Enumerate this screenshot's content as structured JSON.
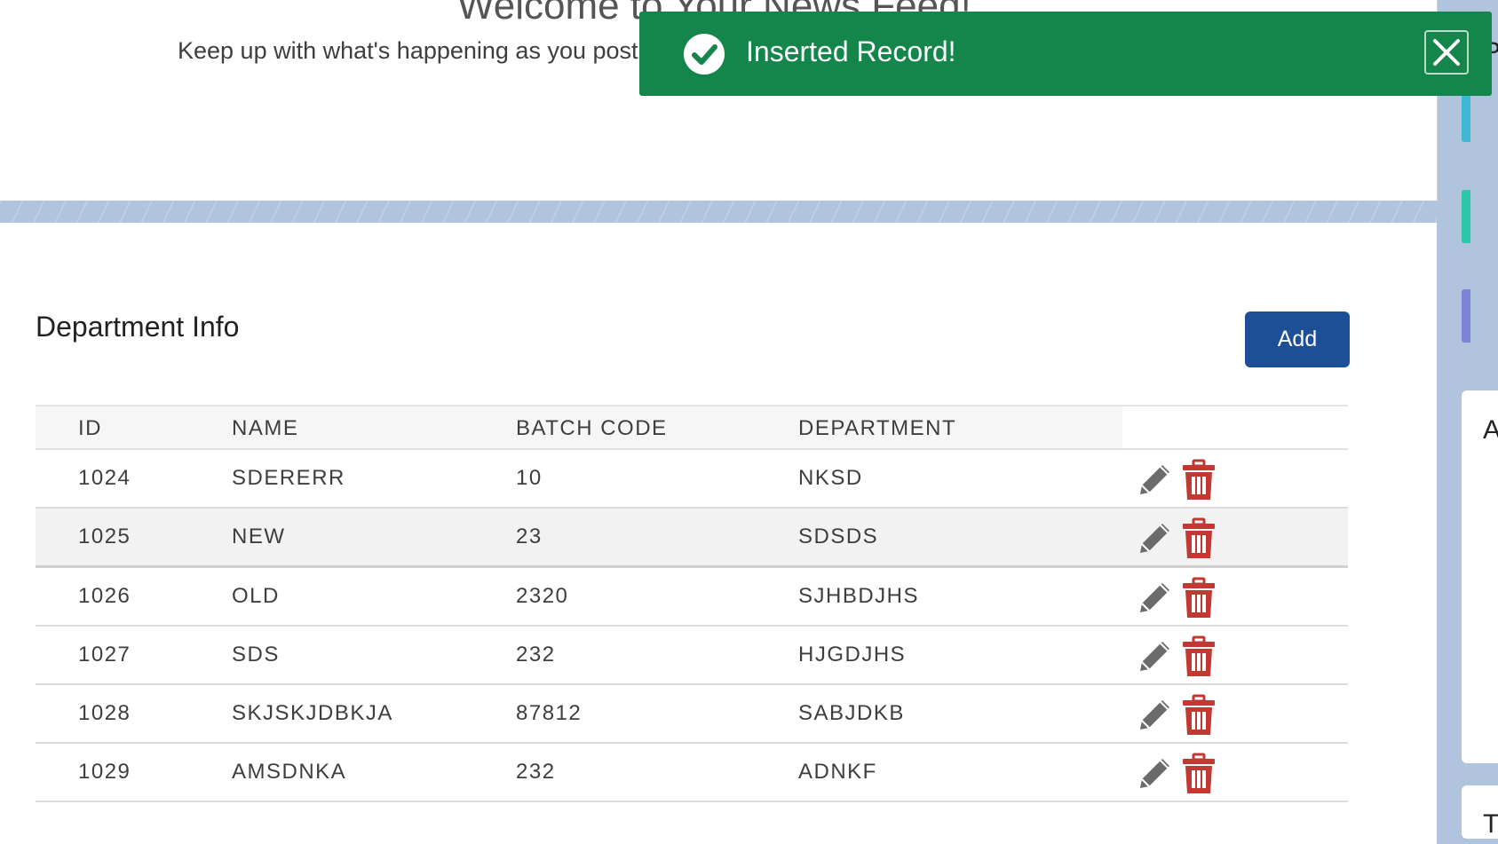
{
  "welcome": {
    "title": "Welcome to Your News Feed!",
    "subtitle": "Keep up with what's happening as you post"
  },
  "toast": {
    "message": "Inserted Record!",
    "icon": "checkmark-icon",
    "close_icon": "close-icon",
    "color": "#14854b"
  },
  "section": {
    "title": "Department Info",
    "add_label": "Add",
    "accent": "#1c4f96"
  },
  "table": {
    "headers": [
      "ID",
      "NAME",
      "BATCH CODE",
      "DEPARTMENT"
    ],
    "rows": [
      [
        "1024",
        "SDERERR",
        "10",
        "NKSD"
      ],
      [
        "1025",
        "NEW",
        "23",
        "SDSDS"
      ],
      [
        "1026",
        "OLD",
        "2320",
        "SJHBDJHS"
      ],
      [
        "1027",
        "SDS",
        "232",
        "HJGDJHS"
      ],
      [
        "1028",
        "SKJSKJDBKJA",
        "87812",
        "SABJDKB"
      ],
      [
        "1029",
        "AMSDNKA",
        "232",
        "ADNKF"
      ]
    ],
    "row_actions": [
      "edit-icon",
      "delete-icon"
    ],
    "delete_color": "#c23934"
  },
  "right_rail": {
    "letters": [
      "P",
      "A",
      "T"
    ]
  }
}
